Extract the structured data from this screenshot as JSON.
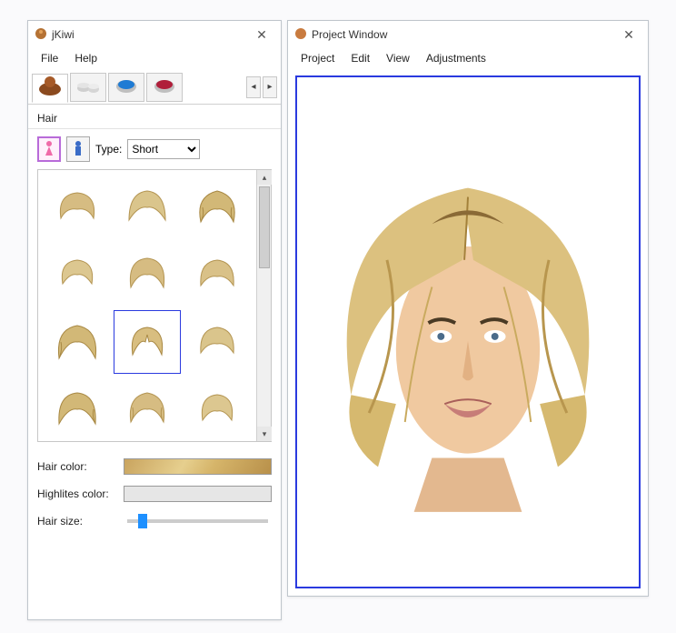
{
  "jkiwi": {
    "title": "jKiwi",
    "menu": {
      "file": "File",
      "help": "Help"
    },
    "tabs": {
      "names": [
        "hair",
        "accessories",
        "makeup1",
        "makeup2"
      ],
      "active": 0,
      "scroll_prev": "◂",
      "scroll_next": "▸"
    },
    "section_label": "Hair",
    "gender": {
      "female_icon": "female-icon",
      "male_icon": "male-icon",
      "active": "female"
    },
    "type_label": "Type:",
    "type_value": "Short",
    "gallery": {
      "rows": 4,
      "cols": 3,
      "selected_index": 7,
      "scroll_up": "▴",
      "scroll_down": "▾"
    },
    "hair_color_label": "Hair color:",
    "highlites_label": "Highlites color:",
    "hair_size_label": "Hair size:",
    "hair_size_value": 0.08,
    "colors": {
      "hair_swatch": "#d6b56a"
    }
  },
  "project": {
    "title": "Project Window",
    "menu": {
      "project": "Project",
      "edit": "Edit",
      "view": "View",
      "adjustments": "Adjustments"
    }
  }
}
